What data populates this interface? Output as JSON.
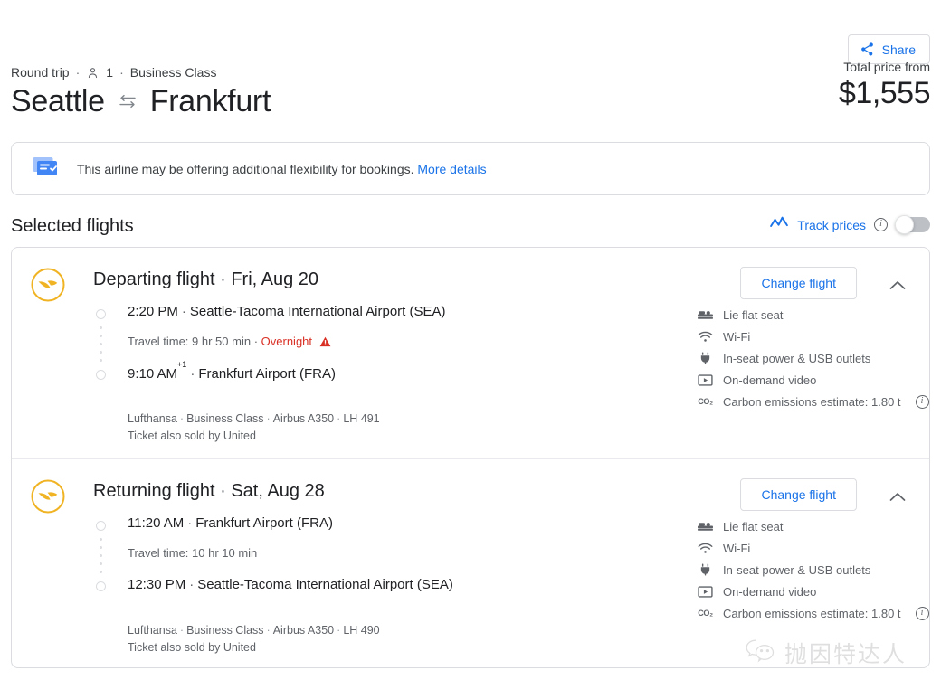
{
  "header": {
    "share_label": "Share",
    "share_icon": "share-icon",
    "trip_type": "Round trip",
    "passenger_icon": "person-icon",
    "passenger_count": "1",
    "cabin_class": "Business Class",
    "origin": "Seattle",
    "swap_icon": "swap-arrows-icon",
    "destination": "Frankfurt",
    "price_label": "Total price from",
    "price_value": "$1,555",
    "dot": "·"
  },
  "banner": {
    "icon": "flexible-ticket-icon",
    "text": "This airline may be offering additional flexibility for bookings.",
    "link_label": "More details"
  },
  "selected_flights": {
    "title": "Selected flights",
    "track_icon": "trending-line-icon",
    "track_label": "Track prices",
    "track_info_icon": "info-icon",
    "toggle_state": "off"
  },
  "colors": {
    "accent_blue": "#1a73e8",
    "lufthansa_gold": "#f0b323",
    "warning_red": "#d93025",
    "border_gray": "#dadce0",
    "text_gray": "#5f6368"
  },
  "legs": [
    {
      "airline_logo": "lufthansa-logo",
      "title": "Departing flight",
      "separator": "·",
      "date": "Fri, Aug 20",
      "change_button": "Change flight",
      "collapse_icon": "chevron-up-icon",
      "depart_time": "2:20 PM",
      "depart_airport": "Seattle-Tacoma International Airport (SEA)",
      "travel_time": "Travel time: 9 hr 50 min",
      "overnight_sep": "·",
      "overnight_label": "Overnight",
      "overnight_icon": "warning-triangle-icon",
      "arrive_time": "9:10 AM",
      "arrive_time_sup": "+1",
      "arrive_airport": "Frankfurt Airport (FRA)",
      "airline": "Lufthansa",
      "cabin": "Business Class",
      "aircraft": "Airbus A350",
      "flight_number": "LH 491",
      "also_sold": "Ticket also sold by United",
      "amenities": [
        {
          "icon": "lie-flat-seat-icon",
          "label": "Lie flat seat",
          "info": false
        },
        {
          "icon": "wifi-icon",
          "label": "Wi-Fi",
          "info": false
        },
        {
          "icon": "power-plug-icon",
          "label": "In-seat power & USB outlets",
          "info": false
        },
        {
          "icon": "on-demand-video-icon",
          "label": "On-demand video",
          "info": false
        },
        {
          "icon": "co2-icon",
          "label": "Carbon emissions estimate: 1.80 t",
          "info": true
        }
      ]
    },
    {
      "airline_logo": "lufthansa-logo",
      "title": "Returning flight",
      "separator": "·",
      "date": "Sat, Aug 28",
      "change_button": "Change flight",
      "collapse_icon": "chevron-up-icon",
      "depart_time": "11:20 AM",
      "depart_airport": "Frankfurt Airport (FRA)",
      "travel_time": "Travel time: 10 hr 10 min",
      "overnight_sep": "",
      "overnight_label": "",
      "overnight_icon": "",
      "arrive_time": "12:30 PM",
      "arrive_time_sup": "",
      "arrive_airport": "Seattle-Tacoma International Airport (SEA)",
      "airline": "Lufthansa",
      "cabin": "Business Class",
      "aircraft": "Airbus A350",
      "flight_number": "LH 490",
      "also_sold": "Ticket also sold by United",
      "amenities": [
        {
          "icon": "lie-flat-seat-icon",
          "label": "Lie flat seat",
          "info": false
        },
        {
          "icon": "wifi-icon",
          "label": "Wi-Fi",
          "info": false
        },
        {
          "icon": "power-plug-icon",
          "label": "In-seat power & USB outlets",
          "info": false
        },
        {
          "icon": "on-demand-video-icon",
          "label": "On-demand video",
          "info": false
        },
        {
          "icon": "co2-icon",
          "label": "Carbon emissions estimate: 1.80 t",
          "info": true
        }
      ]
    }
  ],
  "watermark": {
    "icon": "wechat-icon",
    "text": "抛因特达人"
  }
}
